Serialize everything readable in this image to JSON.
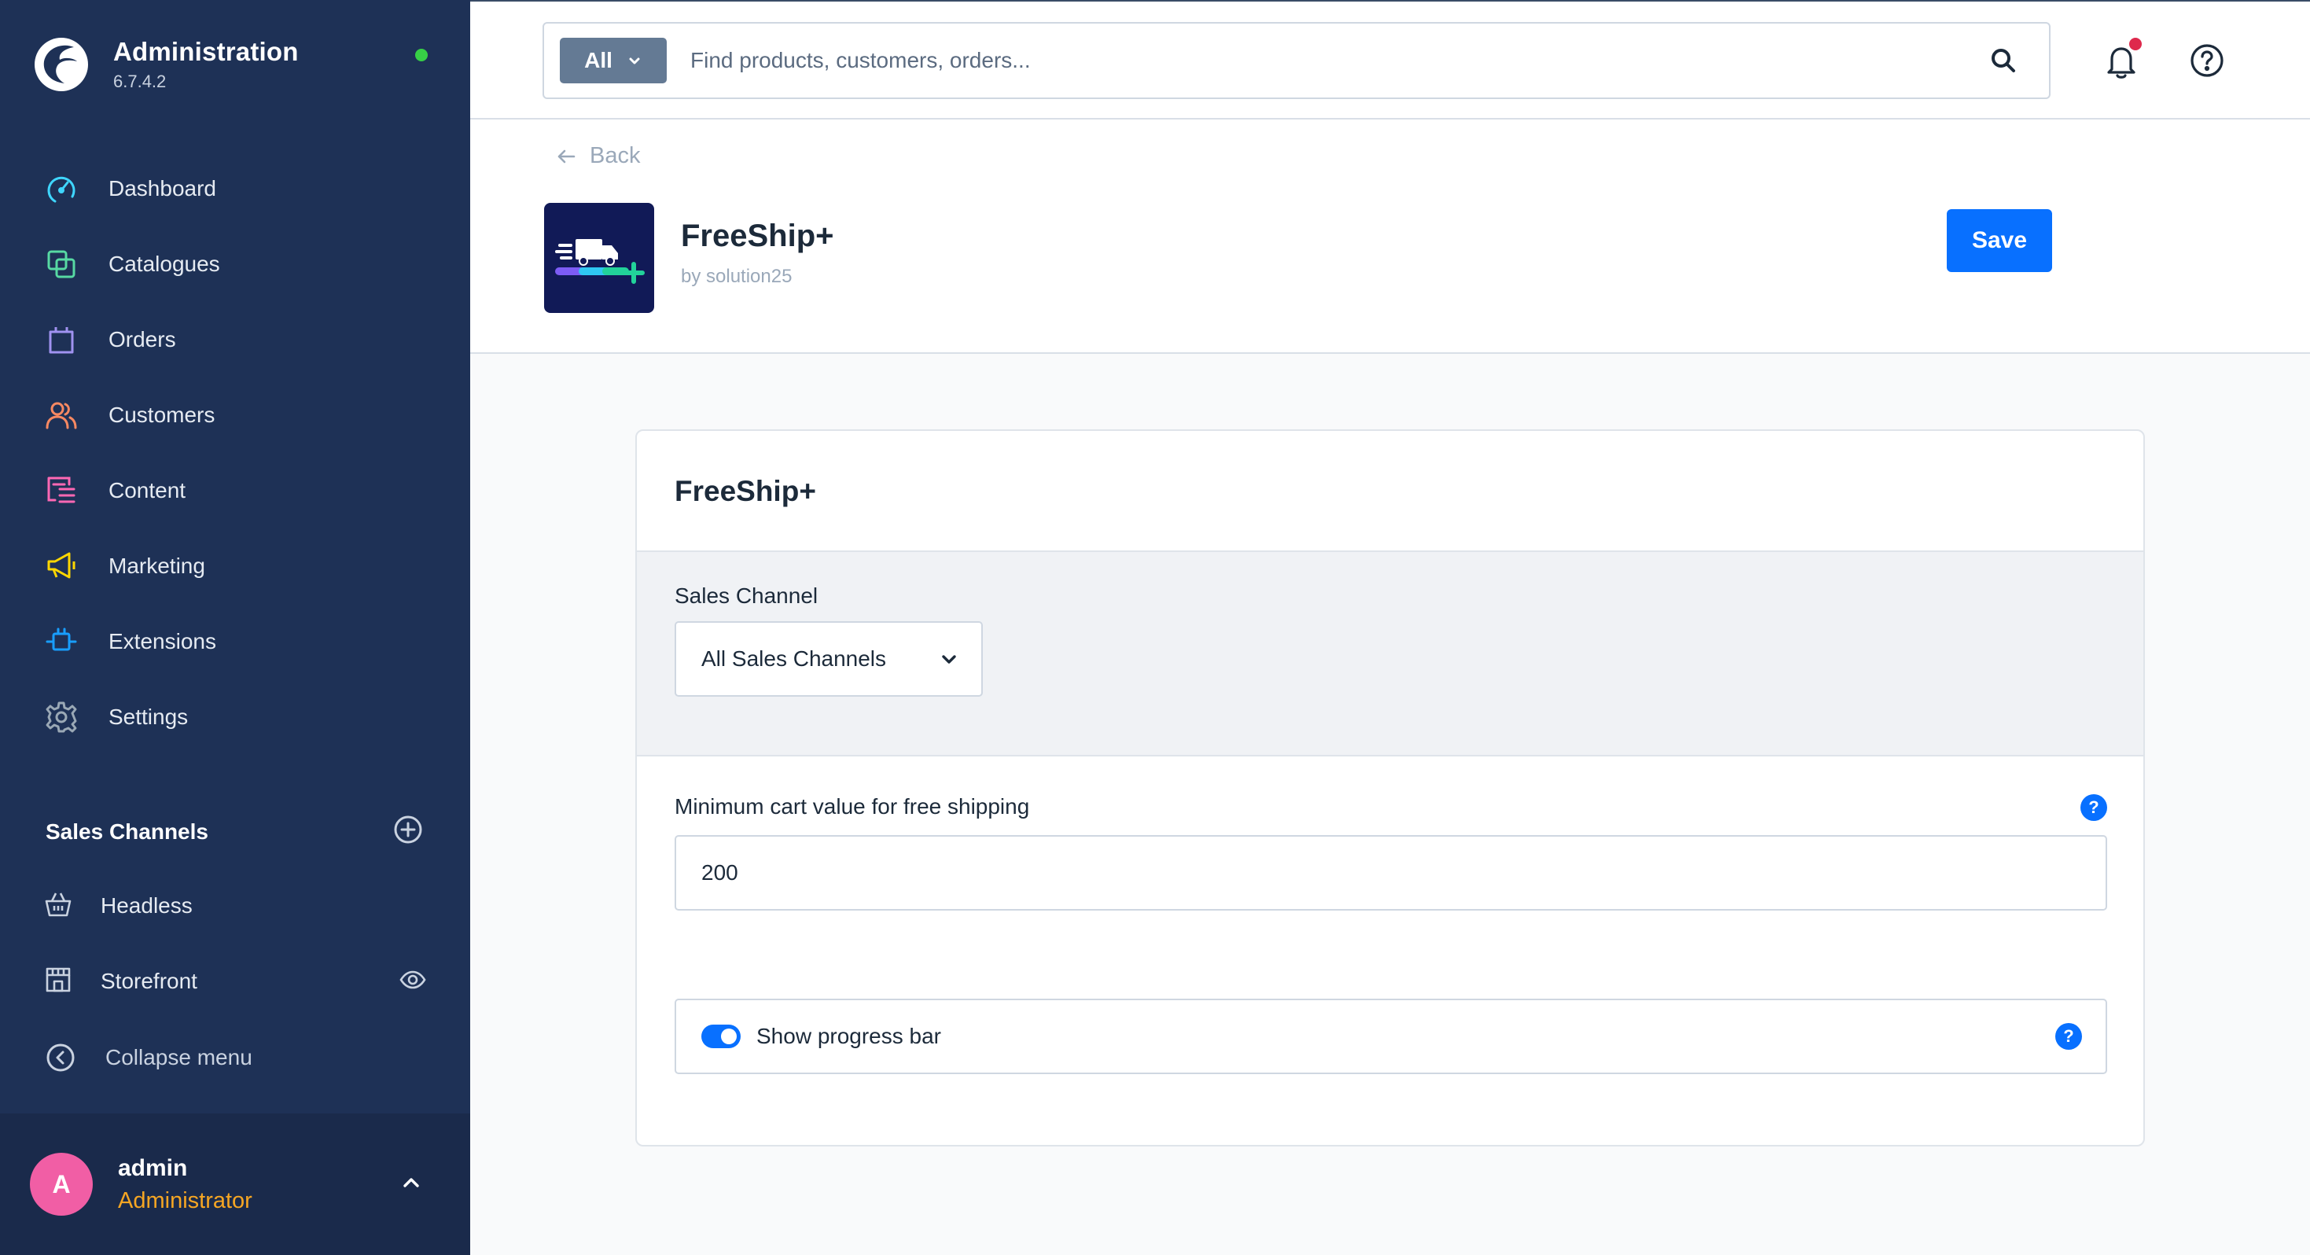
{
  "app": {
    "title": "Administration",
    "version": "6.7.4.2"
  },
  "nav": {
    "items": [
      {
        "label": "Dashboard",
        "icon": "gauge-icon",
        "color": "#3fd6ff"
      },
      {
        "label": "Catalogues",
        "icon": "catalogue-icon",
        "color": "#57d9a3"
      },
      {
        "label": "Orders",
        "icon": "shopping-bag-icon",
        "color": "#a092f0"
      },
      {
        "label": "Customers",
        "icon": "users-icon",
        "color": "#f88962"
      },
      {
        "label": "Content",
        "icon": "content-icon",
        "color": "#ff68b4"
      },
      {
        "label": "Marketing",
        "icon": "megaphone-icon",
        "color": "#ffd700"
      },
      {
        "label": "Extensions",
        "icon": "plug-icon",
        "color": "#189eff"
      },
      {
        "label": "Settings",
        "icon": "gear-icon",
        "color": "#9aa8b5"
      }
    ]
  },
  "sales_channels": {
    "title": "Sales Channels",
    "items": [
      {
        "label": "Headless",
        "icon": "basket-icon"
      },
      {
        "label": "Storefront",
        "icon": "storefront-icon"
      }
    ]
  },
  "collapse": {
    "label": "Collapse menu"
  },
  "user": {
    "initial": "A",
    "name": "admin",
    "role": "Administrator"
  },
  "search": {
    "type_label": "All",
    "placeholder": "Find products, customers, orders..."
  },
  "header": {
    "back_label": "Back",
    "plugin_title": "FreeShip+",
    "plugin_author": "by solution25",
    "save_label": "Save"
  },
  "card": {
    "title": "FreeShip+",
    "sales_channel_label": "Sales Channel",
    "sales_channel_value": "All Sales Channels",
    "min_cart_label": "Minimum cart value for free shipping",
    "min_cart_value": "200",
    "progress_bar_label": "Show progress bar",
    "progress_bar_enabled": true,
    "help_glyph": "?"
  },
  "colors": {
    "sidebar": "#1e3156",
    "primary": "#0870ff",
    "status_online": "#37d046",
    "notification": "#de294c",
    "avatar": "#f15ea5",
    "role": "#f6a623"
  }
}
